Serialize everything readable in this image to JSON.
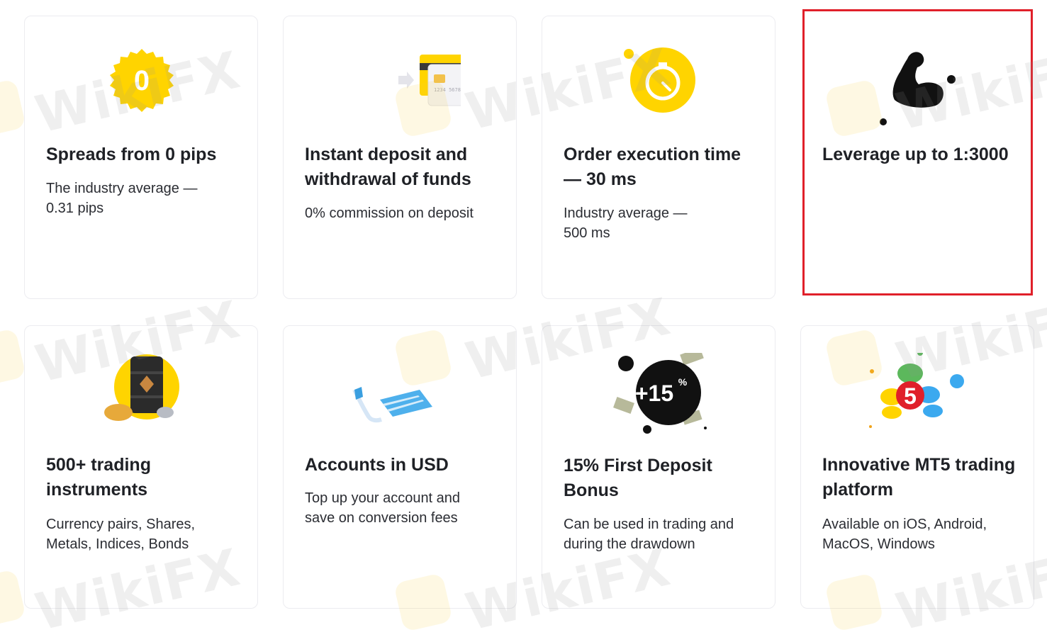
{
  "cards": [
    {
      "title": "Spreads from 0 pips",
      "desc": "The industry average — 0.31 pips",
      "icon": "zero-badge-icon"
    },
    {
      "title": "Instant deposit and withdrawal of funds",
      "desc": "0% commission on deposit",
      "icon": "credit-card-icon"
    },
    {
      "title": "Order execution time — 30 ms",
      "desc": "Industry average — 500 ms",
      "icon": "stopwatch-icon"
    },
    {
      "title": "Leverage up to 1:3000",
      "desc": "",
      "icon": "flexed-biceps-icon"
    },
    {
      "title": "500+ trading instruments",
      "desc": "Currency pairs, Shares, Metals, Indices, Bonds",
      "icon": "oil-barrel-icon"
    },
    {
      "title": "Accounts in USD",
      "desc": "Top up your account and save on conversion fees",
      "icon": "usd-account-icon"
    },
    {
      "title": "15% First Deposit Bonus",
      "desc": "Can be used in trading and during the drawdown",
      "icon": "bonus-badge-icon",
      "badge": "+15",
      "badge_sup": "%"
    },
    {
      "title": "Innovative MT5 trading platform",
      "desc": "Available on iOS, Android, MacOS, Windows",
      "icon": "mt5-logo-icon",
      "badge": "5"
    }
  ],
  "zero_glyph": "0",
  "card_number": "1234 5678",
  "watermark": "WikiFX",
  "colors": {
    "accent": "#ffd400",
    "highlight": "#e0202a",
    "title": "#1f2126"
  }
}
